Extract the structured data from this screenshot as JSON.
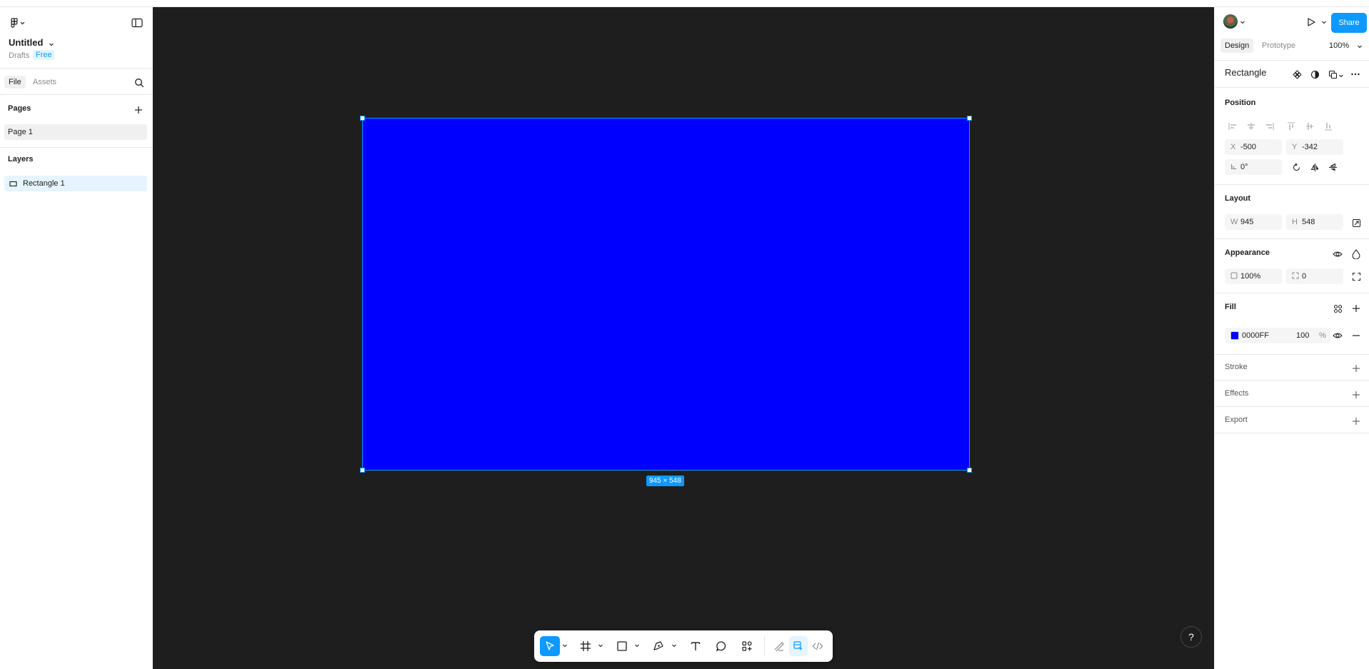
{
  "app": {
    "file_title": "Untitled",
    "breadcrumb": "Drafts",
    "plan_badge": "Free"
  },
  "left_panel": {
    "tabs": [
      {
        "label": "File"
      },
      {
        "label": "Assets"
      }
    ],
    "pages_heading": "Pages",
    "pages": [
      {
        "label": "Page 1"
      }
    ],
    "layers_heading": "Layers",
    "layers": [
      {
        "label": "Rectangle 1",
        "icon": "rectangle-icon"
      }
    ]
  },
  "canvas": {
    "background": "#1e1e1e",
    "shape_fill": "#0000ff",
    "selection_color": "#0d99ff",
    "dimension_label": "945 × 548"
  },
  "toolbar": {
    "tools": [
      "move-tool",
      "frame-tool",
      "rectangle-tool",
      "pen-tool",
      "text-tool",
      "comment-tool",
      "actions-tool",
      "draw-mode",
      "design-mode",
      "dev-mode"
    ],
    "selected_tool": "move-tool"
  },
  "right_panel": {
    "share_label": "Share",
    "tabs": [
      {
        "label": "Design"
      },
      {
        "label": "Prototype"
      }
    ],
    "zoom": "100%",
    "node_title": "Rectangle",
    "position_heading": "Position",
    "x_label": "X",
    "x_value": "-500",
    "y_label": "Y",
    "y_value": "-342",
    "rotation_value": "0°",
    "layout_heading": "Layout",
    "w_label": "W",
    "w_value": "945",
    "h_label": "H",
    "h_value": "548",
    "appearance_heading": "Appearance",
    "opacity_value": "100%",
    "corner_radius_value": "0",
    "fill_heading": "Fill",
    "fill_hex": "0000FF",
    "fill_opacity": "100",
    "fill_opacity_unit": "%",
    "stroke_heading": "Stroke",
    "effects_heading": "Effects",
    "export_heading": "Export"
  },
  "help_label": "?"
}
